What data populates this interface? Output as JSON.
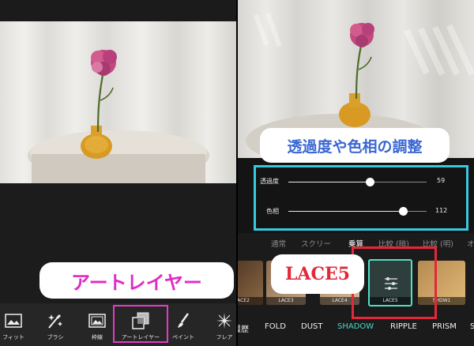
{
  "left": {
    "callout": "アートレイヤー",
    "toolbar": [
      {
        "label": "フィット",
        "icon": "fit-image-icon"
      },
      {
        "label": "ブラシ",
        "icon": "brush-sparkle-icon"
      },
      {
        "label": "枠線",
        "icon": "frame-icon"
      },
      {
        "label": "アートレイヤー",
        "icon": "art-layer-icon"
      },
      {
        "label": "ペイント",
        "icon": "paint-brush-icon"
      },
      {
        "label": "フレア",
        "icon": "flare-icon"
      }
    ]
  },
  "right": {
    "title": "透過度や色相の調整",
    "sliders": [
      {
        "label": "透過度",
        "value": "59",
        "fraction": 0.59
      },
      {
        "label": "色相",
        "value": "112",
        "fraction": 0.83
      }
    ],
    "blend_modes": [
      {
        "label": "通常",
        "active": false
      },
      {
        "label": "スクリー",
        "active": false
      },
      {
        "label": "乗算",
        "active": true
      },
      {
        "label": "比較 (暗)",
        "active": false
      },
      {
        "label": "比較 (明)",
        "active": false
      },
      {
        "label": "オ",
        "active": false
      }
    ],
    "callout": "LACE5",
    "thumbnails": [
      {
        "label": "ACE2",
        "color": "#7a5a3a"
      },
      {
        "label": "LACE3",
        "color": "#b09070"
      },
      {
        "label": "LACE4",
        "color": "#c0a283"
      },
      {
        "label": "LACE5",
        "color": "#2e3e3c",
        "selected": true
      },
      {
        "label": "SHDW1",
        "color": "#c89a5a"
      }
    ],
    "tabs": [
      {
        "label": "履歴",
        "active": false
      },
      {
        "label": "FOLD",
        "active": false
      },
      {
        "label": "DUST",
        "active": false
      },
      {
        "label": "SHADOW",
        "active": true
      },
      {
        "label": "RIPPLE",
        "active": false
      },
      {
        "label": "PRISM",
        "active": false
      },
      {
        "label": "S",
        "active": false
      }
    ]
  },
  "colors": {
    "callout_pink": "#e02bc4",
    "callout_blue": "#3a67d3",
    "callout_red": "#e3283a",
    "highlight_cyan": "#38c9e0",
    "active_teal": "#4fd6c8"
  }
}
